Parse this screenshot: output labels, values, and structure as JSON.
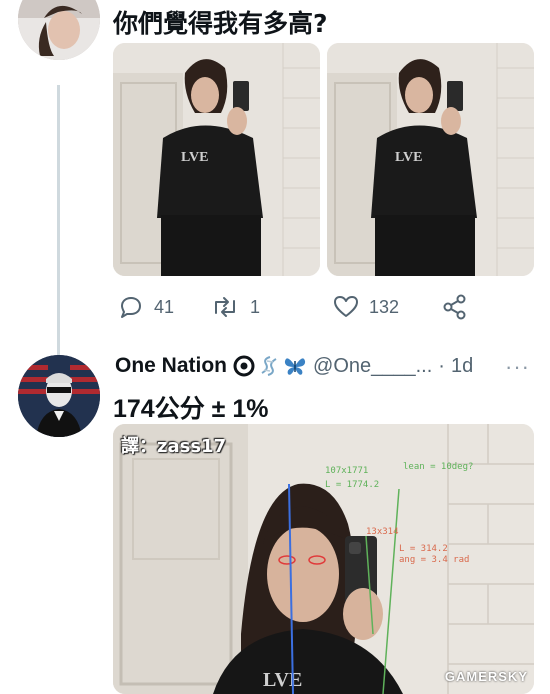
{
  "tweet1": {
    "text": "你們覺得我有多高?",
    "stats": {
      "replies": "41",
      "retweets": "1",
      "likes": "132"
    }
  },
  "reply": {
    "name": "One Nation",
    "handle": "@One____...",
    "separator": "·",
    "time": "1d",
    "text": "174公分 ± 1%",
    "more": "···"
  },
  "overlay": {
    "translator": "譯：zass17",
    "label_box1": "107x1771",
    "label_box2": "L = 1774.2",
    "label_lean": "lean = 10deg?",
    "label_phone": "13x314",
    "label_l2": "L = 314.2",
    "label_ang": "ang = 3.4 rad"
  },
  "watermark": "GAMERSKY",
  "colors": {
    "text": "#0f1419",
    "muted": "#536471",
    "thread": "#cfd9de",
    "measure_green": "#5fb25a",
    "measure_blue": "#3b6fe0",
    "measure_red": "#e03a3a"
  }
}
